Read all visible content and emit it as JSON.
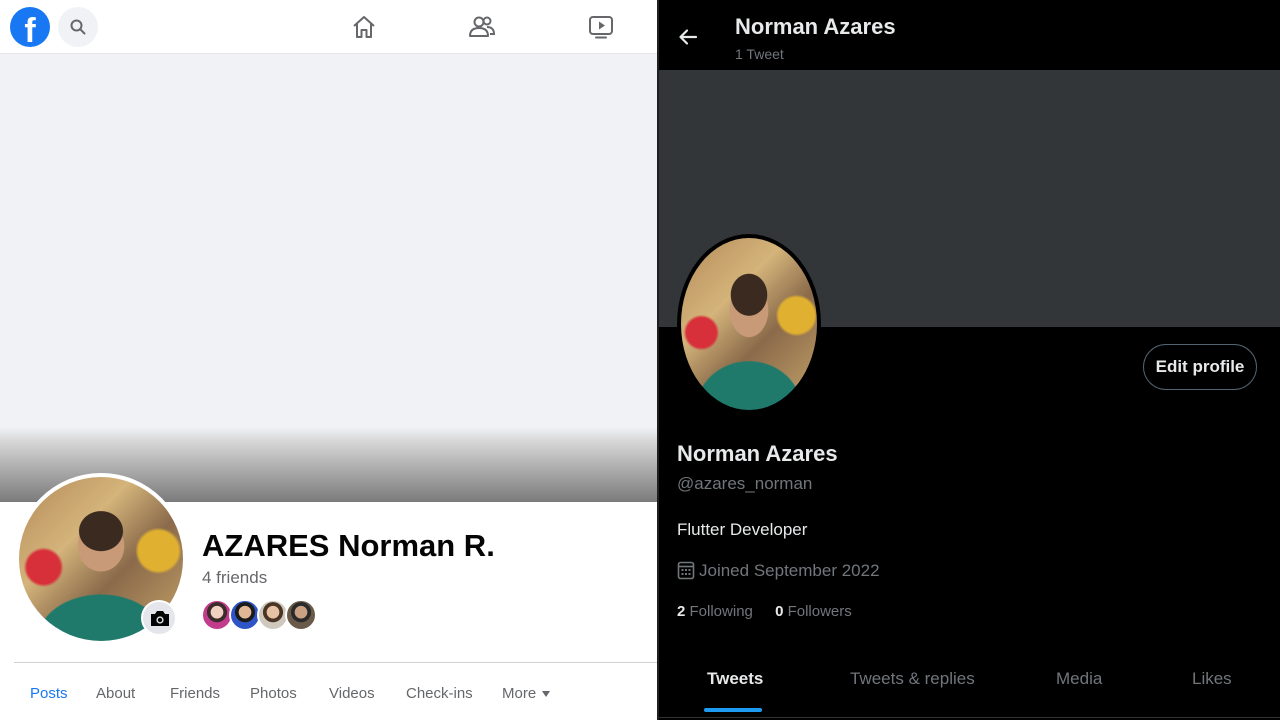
{
  "facebook": {
    "logo_letter": "f",
    "name": "AZARES Norman R.",
    "friends_count": "4 friends",
    "tabs": [
      {
        "label": "Posts",
        "active": true
      },
      {
        "label": "About"
      },
      {
        "label": "Friends"
      },
      {
        "label": "Photos"
      },
      {
        "label": "Videos"
      },
      {
        "label": "Check-ins"
      },
      {
        "label": "More"
      }
    ],
    "nav_icons": [
      "home-icon",
      "friends-icon",
      "watch-icon"
    ],
    "accent": "#1877f2"
  },
  "twitter": {
    "header_name": "Norman Azares",
    "tweet_count": "1 Tweet",
    "edit_profile_label": "Edit profile",
    "name": "Norman Azares",
    "handle": "@azares_norman",
    "bio": "Flutter Developer",
    "joined": "Joined September 2022",
    "following_count": "2",
    "following_label": "Following",
    "followers_count": "0",
    "followers_label": "Followers",
    "tabs": [
      {
        "label": "Tweets",
        "active": true
      },
      {
        "label": "Tweets & replies"
      },
      {
        "label": "Media"
      },
      {
        "label": "Likes"
      }
    ],
    "accent": "#1d9bf0"
  }
}
